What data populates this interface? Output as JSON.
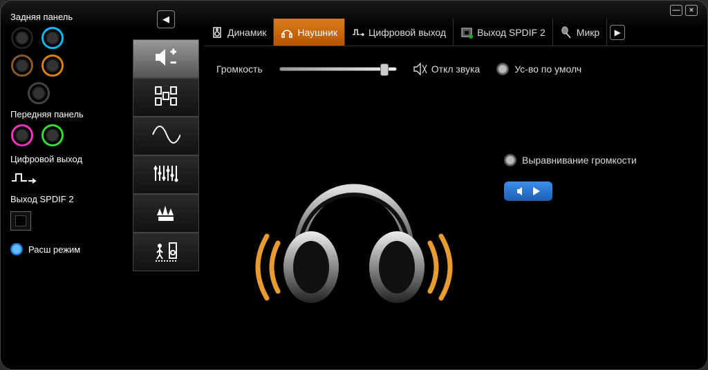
{
  "window": {
    "minimize": "—",
    "close": "×"
  },
  "left": {
    "rear_panel": "Задняя панель",
    "front_panel": "Передняя панель",
    "digital_out": "Цифровой выход",
    "spdif": "Выход SPDIF 2",
    "ext_mode": "Расш режим",
    "jacks_rear": [
      [
        "#000",
        "#0bf"
      ],
      [
        "#8b4513",
        "#e08000"
      ],
      [
        "#888",
        "#f5c"
      ]
    ],
    "jacks_front": [
      [
        "#f3b",
        "#e6e"
      ],
      [
        "#4b5",
        "#2f2"
      ]
    ]
  },
  "tabs": [
    {
      "id": "speaker",
      "label": "Динамик",
      "icon": "speaker"
    },
    {
      "id": "headphone",
      "label": "Наушник",
      "icon": "headphone",
      "active": true
    },
    {
      "id": "digital",
      "label": "Цифровой выход",
      "icon": "digital"
    },
    {
      "id": "spdif2",
      "label": "Выход SPDIF 2",
      "icon": "spdif"
    },
    {
      "id": "mic",
      "label": "Микр",
      "icon": "mic"
    }
  ],
  "nav": [
    {
      "id": "volume",
      "icon": "volplus",
      "active": true
    },
    {
      "id": "speakers",
      "icon": "multispk"
    },
    {
      "id": "wave",
      "icon": "sine"
    },
    {
      "id": "eq",
      "icon": "equalizer"
    },
    {
      "id": "env",
      "icon": "forest"
    },
    {
      "id": "room",
      "icon": "room"
    }
  ],
  "controls": {
    "volume_label": "Громкость",
    "volume_percent": 90,
    "mute": "Откл звука",
    "default_device": "Ус-во по умолч",
    "loudness": "Выравнивание громкости"
  }
}
